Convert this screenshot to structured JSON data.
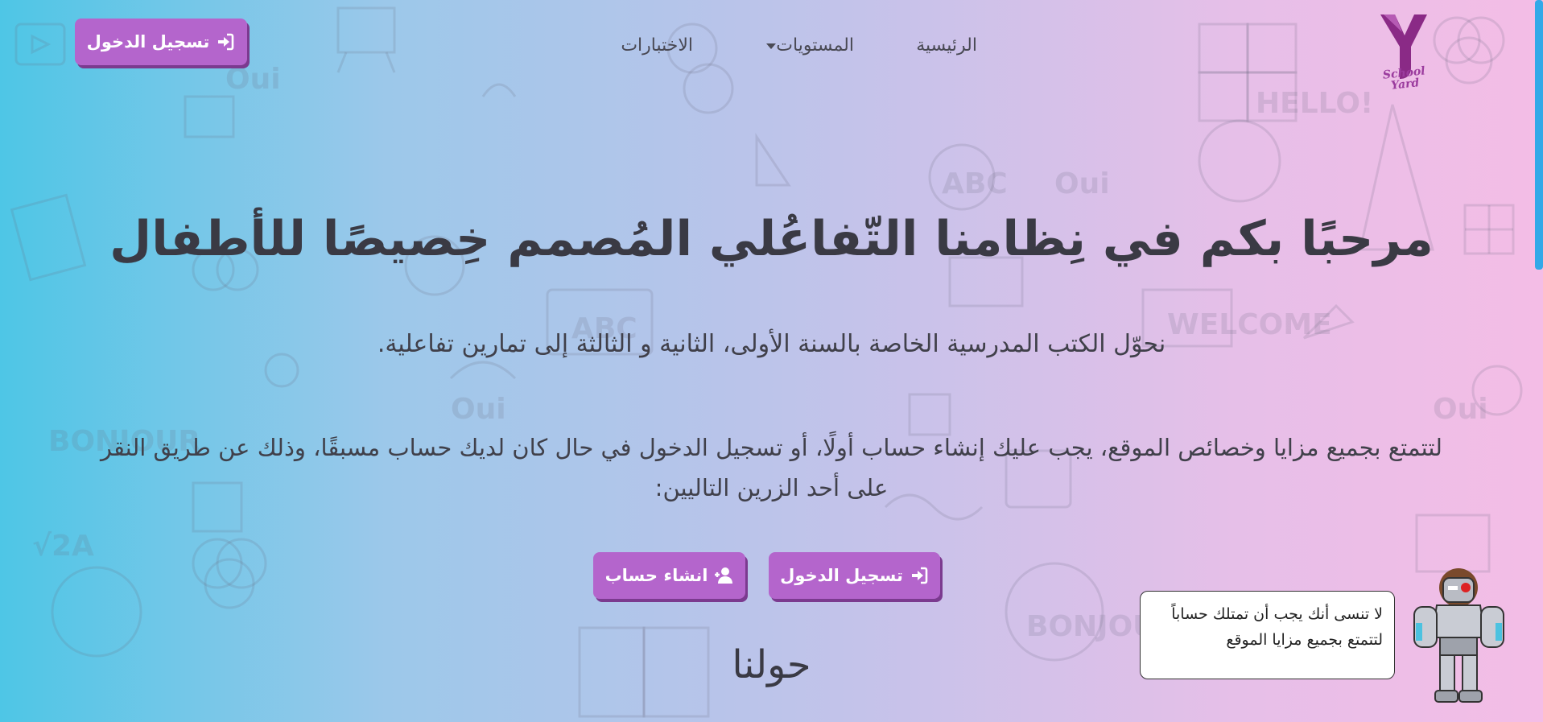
{
  "colors": {
    "accent_button": "#b465cc",
    "button_shadow": "#7b3a8f",
    "gradient_left": "#4ec6e6",
    "gradient_right": "#f4bde6",
    "scrollbar": "#33a9e8",
    "text_dark": "#3a3a44"
  },
  "logo": {
    "text_line1": "School",
    "text_line2": "Yard",
    "icon": "y-logo-icon"
  },
  "nav": {
    "home_label": "الرئيسية",
    "levels_label": "المستويات",
    "tests_label": "الاختبارات"
  },
  "header": {
    "login_label": "تسجيل الدخول",
    "login_icon": "sign-in-icon"
  },
  "hero": {
    "title": "مرحبًا بكم في نِظامنا التّفاعُلي المُصمم خِصيصًا للأطفال",
    "subtitle": "نحوّل الكتب المدرسية الخاصة بالسنة الأولى، الثانية و الثالثة إلى تمارين تفاعلية.",
    "paragraph": "لتتمتع بجميع مزايا وخصائص الموقع، يجب عليك إنشاء حساب أولًا، أو تسجيل الدخول في حال كان لديك حساب مسبقًا، وذلك عن طريق النقر على أحد الزرين التاليين:",
    "login_label": "تسجيل الدخول",
    "login_icon": "sign-in-icon",
    "register_label": "انشاء حساب",
    "register_icon": "user-plus-icon"
  },
  "about": {
    "title": "حولنا"
  },
  "tooltip": {
    "line1": "لا تنسى أنك يجب أن تمتلك حساباً",
    "line2": "لتتمتع بجميع مزايا الموقع"
  },
  "scroll": {
    "position_fraction": 0
  }
}
